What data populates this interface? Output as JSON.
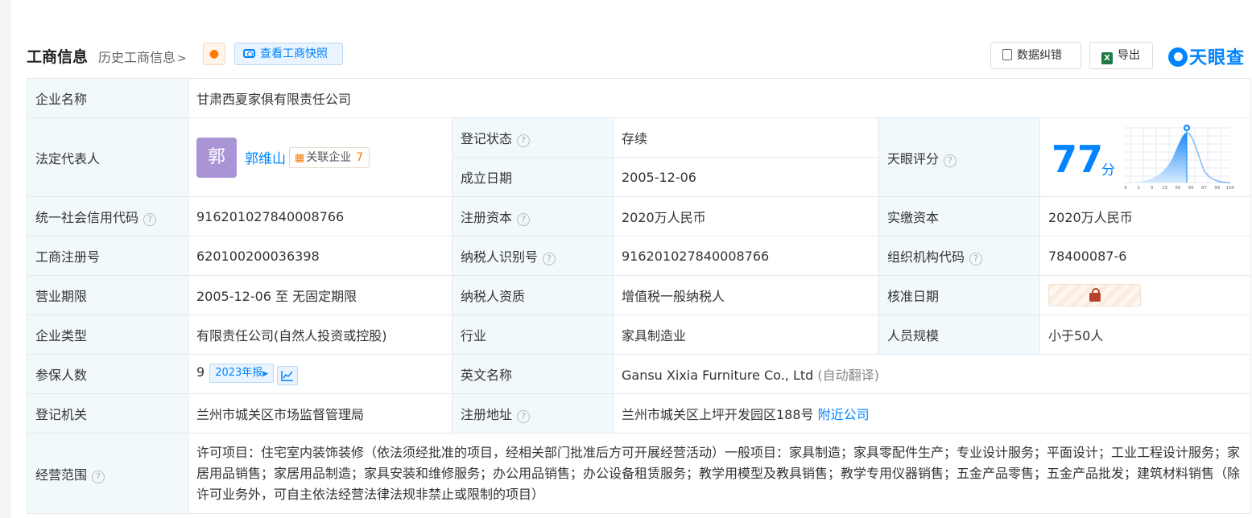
{
  "header": {
    "title": "工商信息",
    "history_link": "历史工商信息",
    "snapshot_button": "查看工商快照",
    "correct_button": "数据纠错",
    "export_button": "导出",
    "logo_text": "天眼查",
    "excel_badge": "X",
    "brand_color": "#0084ff"
  },
  "company_name": {
    "label": "企业名称",
    "value": "甘肃西夏家俱有限责任公司"
  },
  "legal_rep": {
    "label": "法定代表人",
    "avatar_char": "郭",
    "name": "郭维山",
    "related_label": "关联企业",
    "related_count": "7"
  },
  "reg_status": {
    "label": "登记状态",
    "value": "存续"
  },
  "found_date": {
    "label": "成立日期",
    "value": "2005-12-06"
  },
  "tianyan_score": {
    "label": "天眼评分",
    "score": "77",
    "unit": "分",
    "axis_ticks": [
      "0",
      "1",
      "3",
      "15",
      "50",
      "85",
      "97",
      "99",
      "100"
    ]
  },
  "credit_code": {
    "label": "统一社会信用代码",
    "value": "916201027840008766"
  },
  "reg_capital": {
    "label": "注册资本",
    "value": "2020万人民币"
  },
  "paid_capital": {
    "label": "实缴资本",
    "value": "2020万人民币"
  },
  "reg_no": {
    "label": "工商注册号",
    "value": "620100200036398"
  },
  "taxpayer_id": {
    "label": "纳税人识别号",
    "value": "916201027840008766"
  },
  "org_code": {
    "label": "组织机构代码",
    "value": "78400087-6"
  },
  "business_term": {
    "label": "营业期限",
    "value": "2005-12-06 至 无固定期限"
  },
  "taxpayer_qual": {
    "label": "纳税人资质",
    "value": "增值税一般纳税人"
  },
  "approval_date": {
    "label": "核准日期"
  },
  "company_type": {
    "label": "企业类型",
    "value": "有限责任公司(自然人投资或控股)"
  },
  "industry": {
    "label": "行业",
    "value": "家具制造业"
  },
  "staff_size": {
    "label": "人员规模",
    "value": "小于50人"
  },
  "insured": {
    "label": "参保人数",
    "value": "9",
    "year_report": "2023年报"
  },
  "english_name": {
    "label": "英文名称",
    "value": "Gansu Xixia Furniture Co., Ltd",
    "note": "(自动翻译)"
  },
  "reg_authority": {
    "label": "登记机关",
    "value": "兰州市城关区市场监督管理局"
  },
  "reg_address": {
    "label": "注册地址",
    "value": "兰州市城关区上坪开发园区188号",
    "nearby_link": "附近公司"
  },
  "business_scope": {
    "label": "经营范围",
    "value": "许可项目：住宅室内装饰装修（依法须经批准的项目，经相关部门批准后方可开展经营活动）一般项目：家具制造；家具零配件生产；专业设计服务；平面设计；工业工程设计服务；家居用品销售；家居用品制造；家具安装和维修服务；办公用品销售；办公设备租赁服务；教学用模型及教具销售；教学专用仪器销售；五金产品零售；五金产品批发；建筑材料销售（除许可业务外，可自主依法经营法律法规非禁止或限制的项目）"
  }
}
